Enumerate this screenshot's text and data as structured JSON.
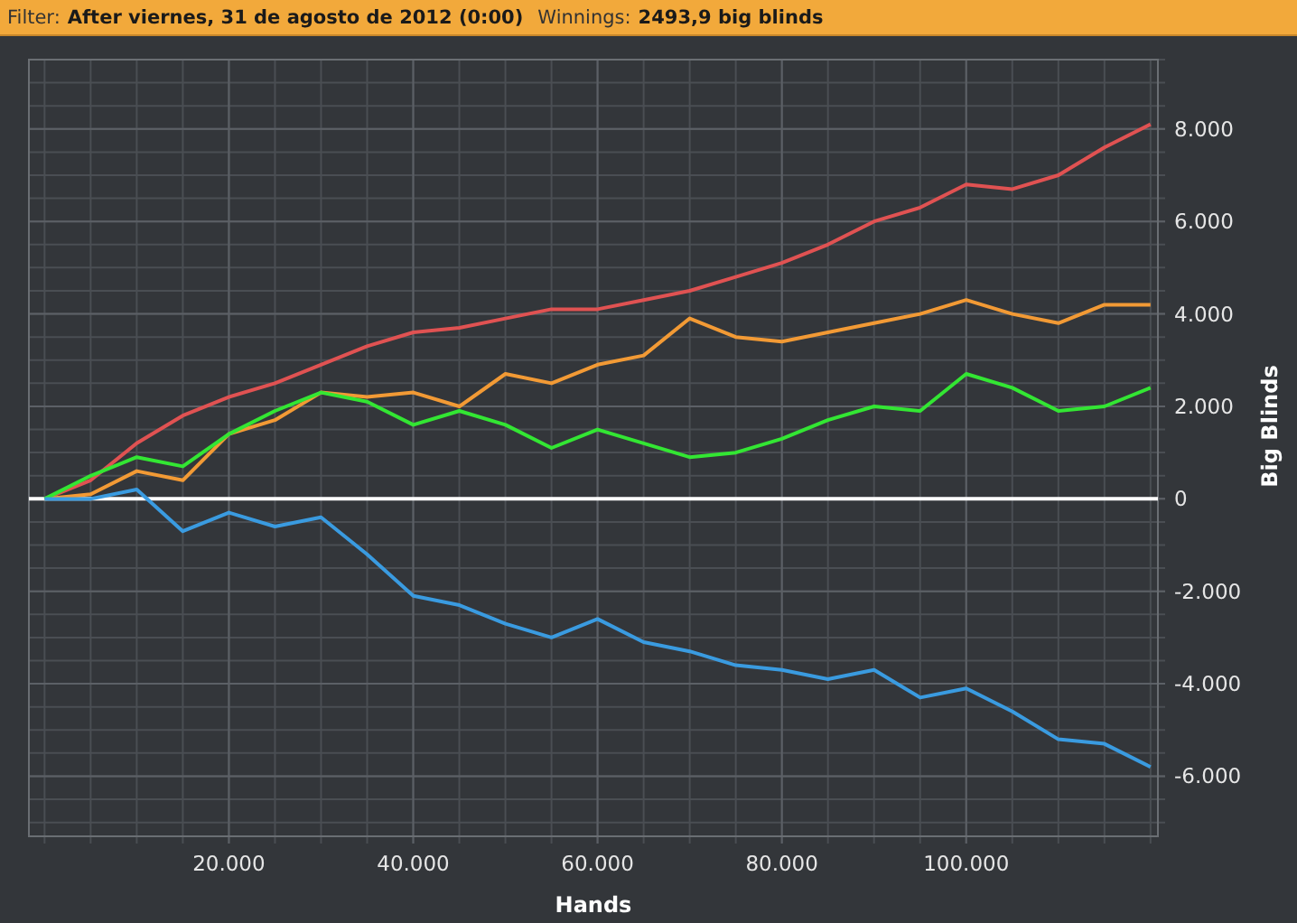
{
  "filter_bar": {
    "filter_label": "Filter:",
    "filter_value": "After viernes, 31 de agosto de 2012 (0:00)",
    "winnings_label": "Winnings:",
    "winnings_value": "2493,9 big blinds"
  },
  "chart": {
    "chart_data": {
      "type": "line",
      "xlabel": "Hands",
      "ylabel": "Big Blinds",
      "x": [
        0,
        5000,
        10000,
        15000,
        20000,
        25000,
        30000,
        35000,
        40000,
        45000,
        50000,
        55000,
        60000,
        65000,
        70000,
        75000,
        80000,
        85000,
        90000,
        95000,
        100000,
        105000,
        110000,
        115000,
        120000
      ],
      "series": [
        {
          "color": "#e05252",
          "values": [
            0,
            400,
            1200,
            1800,
            2200,
            2500,
            2900,
            3300,
            3600,
            3700,
            3900,
            4100,
            4100,
            4300,
            4500,
            4800,
            5100,
            5500,
            6000,
            6300,
            6800,
            6700,
            7000,
            7600,
            8100
          ]
        },
        {
          "color": "#f29a35",
          "values": [
            0,
            100,
            600,
            400,
            1400,
            1700,
            2300,
            2200,
            2300,
            2000,
            2700,
            2500,
            2900,
            3100,
            3900,
            3500,
            3400,
            3600,
            3800,
            4000,
            4300,
            4000,
            3800,
            4200,
            4200
          ]
        },
        {
          "color": "#33e633",
          "values": [
            0,
            500,
            900,
            700,
            1400,
            1900,
            2300,
            2100,
            1600,
            1900,
            1600,
            1100,
            1500,
            1200,
            900,
            1000,
            1300,
            1700,
            2000,
            1900,
            2700,
            2400,
            1900,
            2000,
            2400
          ]
        },
        {
          "color": "#3a9be0",
          "values": [
            0,
            0,
            200,
            -700,
            -300,
            -600,
            -400,
            -1200,
            -2100,
            -2300,
            -2700,
            -3000,
            -2600,
            -3100,
            -3300,
            -3600,
            -3700,
            -3900,
            -3700,
            -4300,
            -4100,
            -4600,
            -5200,
            -5300,
            -5800
          ]
        }
      ],
      "grid": true,
      "xlim": [
        -1700,
        120800
      ],
      "ylim": [
        -7300,
        9500
      ],
      "xticks": [
        {
          "value": 20000,
          "label": "20.000"
        },
        {
          "value": 40000,
          "label": "40.000"
        },
        {
          "value": 60000,
          "label": "60.000"
        },
        {
          "value": 80000,
          "label": "80.000"
        },
        {
          "value": 100000,
          "label": "100.000"
        }
      ],
      "yticks": [
        {
          "value": -6000,
          "label": "-6.000"
        },
        {
          "value": -4000,
          "label": "-4.000"
        },
        {
          "value": -2000,
          "label": "-2.000"
        },
        {
          "value": 0,
          "label": "0"
        },
        {
          "value": 2000,
          "label": "2.000"
        },
        {
          "value": 4000,
          "label": "4.000"
        },
        {
          "value": 6000,
          "label": "6.000"
        },
        {
          "value": 8000,
          "label": "8.000"
        }
      ]
    }
  }
}
